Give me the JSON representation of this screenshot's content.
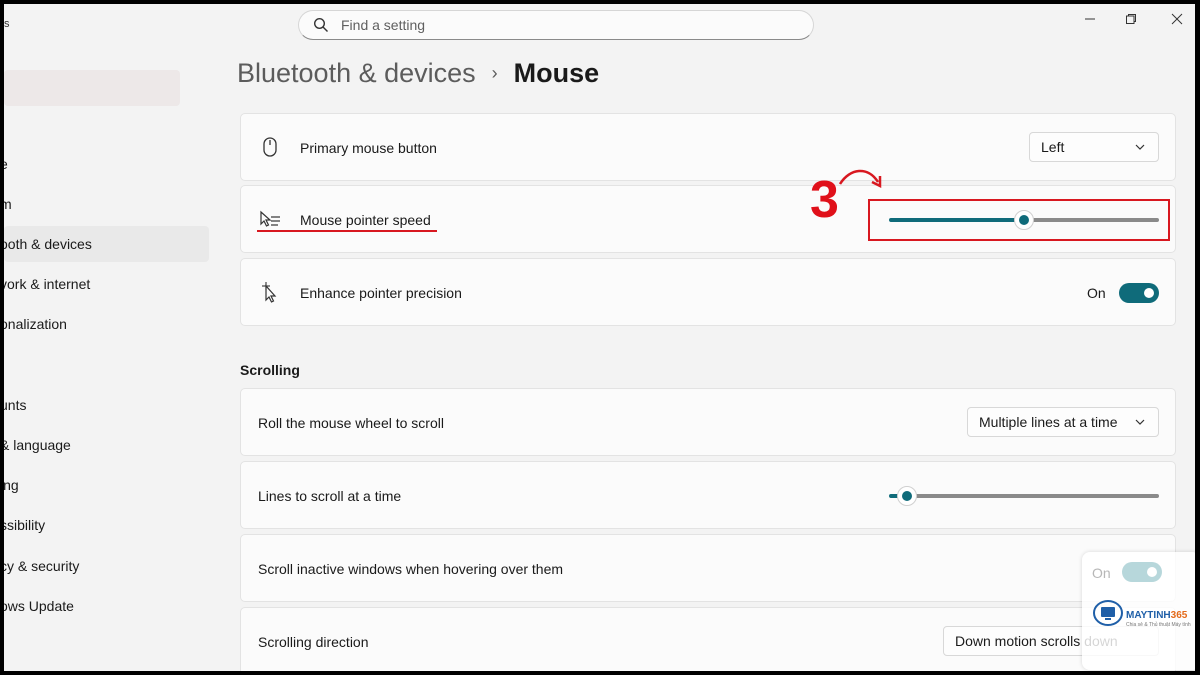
{
  "search": {
    "placeholder": "Find a setting"
  },
  "title_bar": {
    "left_glyph": "s"
  },
  "window_controls": [
    "minimize-icon",
    "restore-icon",
    "close-icon"
  ],
  "sidebar": {
    "items": [
      {
        "label": "e"
      },
      {
        "label": "m"
      },
      {
        "label": "ooth & devices",
        "active": true
      },
      {
        "label": "vork & internet"
      },
      {
        "label": "onalization"
      },
      {
        "label": ""
      },
      {
        "label": "unts"
      },
      {
        "label": "& language"
      },
      {
        "label": "ing"
      },
      {
        "label": "ssibility"
      },
      {
        "label": "cy & security"
      },
      {
        "label": "ows Update"
      }
    ]
  },
  "header": {
    "parent": "Bluetooth & devices",
    "current": "Mouse"
  },
  "settings": {
    "primary_button": {
      "label": "Primary mouse button",
      "value": "Left",
      "icon": "mouse-icon"
    },
    "pointer_speed": {
      "label": "Mouse pointer speed",
      "level": 0.5,
      "icon": "pointer-speed-icon"
    },
    "precision": {
      "label": "Enhance pointer precision",
      "state_label": "On",
      "enabled": true,
      "icon": "pointer-precision-icon"
    }
  },
  "scrolling": {
    "title": "Scrolling",
    "wheel": {
      "label": "Roll the mouse wheel to scroll",
      "value": "Multiple lines at a time"
    },
    "lines": {
      "label": "Lines to scroll at a time",
      "level": 0.03
    },
    "inactive": {
      "label": "Scroll inactive windows when hovering over them",
      "state_label": "On",
      "enabled": true
    },
    "direction": {
      "label": "Scrolling direction",
      "value": "Down motion scrolls down"
    }
  },
  "annotation": {
    "step": "3"
  },
  "watermark": {
    "brand_a": "MAYTINH",
    "brand_b": "365",
    "tagline": "Chia sẻ & Thủ thuật Máy tính"
  },
  "colors": {
    "accent": "#0f6b7a",
    "annotation": "#d81820",
    "track": "#8a8a8a"
  }
}
